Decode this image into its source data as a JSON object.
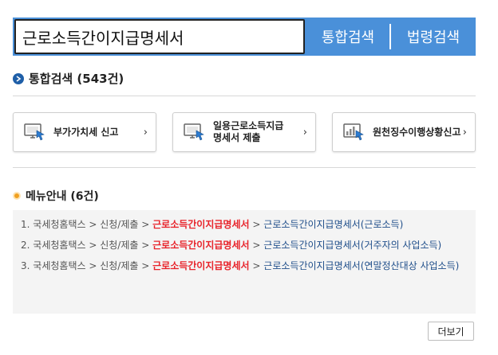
{
  "search": {
    "query": "근로소득간이지급명세서",
    "integrated_label": "통합검색",
    "law_label": "법령검색"
  },
  "integrated": {
    "title": "통합검색 (543건)"
  },
  "shortcuts": [
    {
      "label": "부가가치세 신고",
      "icon": "monitor-cursor-icon"
    },
    {
      "label": "일용근로소득지급\n명세서 제출",
      "icon": "monitor-cursor-icon"
    },
    {
      "label": "원천징수이행상황신고",
      "icon": "chart-cursor-icon"
    }
  ],
  "menu": {
    "title": "메뉴안내 (6건)",
    "results": [
      {
        "num": "1.",
        "path": "국세청홈택스 > 신청/제출 >",
        "highlight": "근로소득간이지급명세서",
        "sep": ">",
        "final": "근로소득간이지급명세서(근로소득)"
      },
      {
        "num": "2.",
        "path": "국세청홈택스 > 신청/제출 >",
        "highlight": "근로소득간이지급명세서",
        "sep": ">",
        "final": "근로소득간이지급명세서(거주자의 사업소득)"
      },
      {
        "num": "3.",
        "path": "국세청홈택스 > 신청/제출 >",
        "highlight": "근로소득간이지급명세서",
        "sep": ">",
        "final": "근로소득간이지급명세서(연말정산대상 사업소득)"
      }
    ]
  },
  "more_label": "더보기",
  "colors": {
    "search_bar": "#4a90d9",
    "highlight": "#e8232a",
    "link": "#1f4e8a"
  }
}
